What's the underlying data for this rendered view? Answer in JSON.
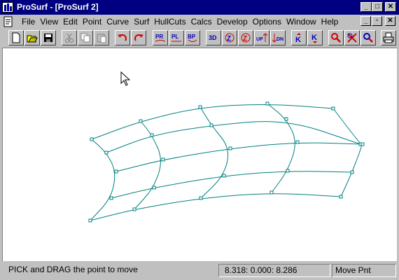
{
  "window": {
    "title": "ProSurf - [ProSurf 2]",
    "controls": {
      "minimize": "_",
      "maximize": "□",
      "close": "✕"
    },
    "mdi_controls": {
      "minimize": "_",
      "restore": "▫",
      "close": "✕"
    }
  },
  "menu": {
    "items": [
      "File",
      "View",
      "Edit",
      "Point",
      "Curve",
      "Surf",
      "HullCuts",
      "Calcs",
      "Develop",
      "Options",
      "Window",
      "Help"
    ]
  },
  "toolbar": {
    "buttons": [
      {
        "name": "new-icon"
      },
      {
        "name": "open-icon"
      },
      {
        "name": "save-icon"
      },
      {
        "name": "cut-icon"
      },
      {
        "name": "copy-icon"
      },
      {
        "name": "paste-icon"
      },
      {
        "name": "undo-icon"
      },
      {
        "name": "redo-icon"
      },
      {
        "name": "pr-view-icon",
        "text": "PR"
      },
      {
        "name": "pl-view-icon",
        "text": "PL"
      },
      {
        "name": "bp-view-icon",
        "text": "BP"
      },
      {
        "name": "3d-view-icon",
        "text": "3D"
      },
      {
        "name": "rotate-z-icon",
        "text": "Z"
      },
      {
        "name": "rotate-z2-icon",
        "text": "Z"
      },
      {
        "name": "up-icon",
        "text": "UP"
      },
      {
        "name": "dn-icon",
        "text": "DN"
      },
      {
        "name": "k-up-icon",
        "text": "K"
      },
      {
        "name": "k-down-icon",
        "text": "K"
      },
      {
        "name": "zoom-icon"
      },
      {
        "name": "cross-icon"
      },
      {
        "name": "pan-icon"
      },
      {
        "name": "print-icon"
      }
    ]
  },
  "status": {
    "message": "PICK and DRAG the point to move",
    "coords": "8.318:  0.000:  8.286",
    "mode": "Move Pnt"
  },
  "colors": {
    "title_bar": "#000080",
    "surface_lines": "#008080",
    "control_points": "#008080",
    "canvas": "#ffffff"
  }
}
